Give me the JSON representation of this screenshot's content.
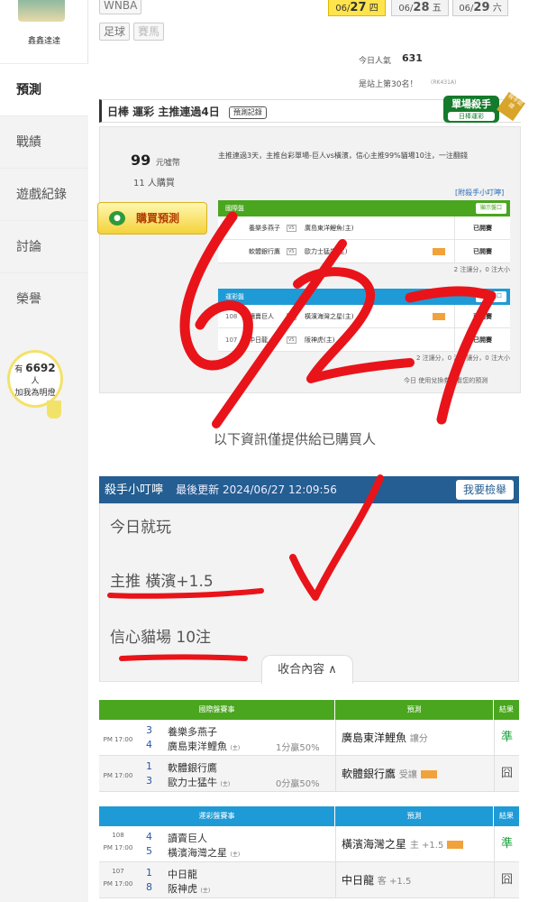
{
  "sidebar": {
    "username": "鑫鑫達達",
    "items": [
      {
        "label": "預測",
        "active": true
      },
      {
        "label": "戰績",
        "active": false
      },
      {
        "label": "遊戲紀錄",
        "active": false
      },
      {
        "label": "討論",
        "active": false
      },
      {
        "label": "榮譽",
        "active": false
      }
    ],
    "fans": {
      "prefix": "有",
      "count": "6692",
      "suffix": "人",
      "cta": "加我為明燈"
    }
  },
  "sport_tags": [
    "WNBA",
    "足球",
    "賽馬"
  ],
  "dates": [
    {
      "month_prefix": "06/",
      "day": "27",
      "weekday": "四",
      "active": true
    },
    {
      "month_prefix": "06/",
      "day": "28",
      "weekday": "五",
      "active": false
    },
    {
      "month_prefix": "06/",
      "day": "29",
      "weekday": "六",
      "active": false
    }
  ],
  "popularity": {
    "label": "今日人氣",
    "value": "631",
    "rank_text": "是站上第30名！",
    "rank_sub": "(RK431A)"
  },
  "prediction": {
    "title": "日棒 運彩 主推連過4日",
    "record_button": "預測記錄",
    "badge_title": "單場殺手",
    "badge_sub": "日棒運彩",
    "badge_corner": "殺手認證",
    "price": "99",
    "price_unit": "元噓幣",
    "buyers": "11 人購買",
    "buy_button": "購買預測",
    "summary": "主推連過3天，主推台彩單場-巨人vs橫濱，信心主推99%貓場10注，一注翻錢",
    "link_note": "[附殺手小叮嚀]",
    "intl_table": {
      "title": "國際盤",
      "show_btn": "顯示盤口",
      "rows": [
        {
          "num": "",
          "home": "養樂多燕子",
          "away": "廣島東洋鯉魚(主)",
          "flag": false,
          "status": "已開賽"
        },
        {
          "num": "",
          "home": "軟體銀行鷹",
          "away": "歐力士猛牛(主)",
          "flag": true,
          "status": "已開賽"
        }
      ],
      "note": "2 注讓分，0 注大小"
    },
    "sport_table": {
      "title": "運彩盤",
      "show_btn": "顯示盤口",
      "rows": [
        {
          "num": "108",
          "home": "讀賣巨人",
          "away": "橫濱海灣之星(主)",
          "flag": true,
          "status": "已開賽"
        },
        {
          "num": "107",
          "home": "中日龍",
          "away": "阪神虎(主)",
          "flag": false,
          "status": "已開賽"
        }
      ],
      "note": "2 注讓分，0 注不讓分，0 注大小"
    },
    "bottom_note": "今日 使用兌換券觀看您的預測"
  },
  "info_line": "以下資訊僅提供給已購買人",
  "notes": {
    "header": "殺手小叮嚀",
    "updated": "最後更新 2024/06/27 12:09:56",
    "report_button": "我要檢舉",
    "line1": "今日就玩",
    "line2": "主推 橫濱+1.5",
    "line3": "信心貓場 10注",
    "collapse_button": "收合內容 ∧"
  },
  "result_tables": [
    {
      "head_event": "國際盤賽事",
      "head_pick": "預測",
      "head_result": "結果",
      "color": "#4aa61f",
      "rows": [
        {
          "time1": "",
          "time2": "PM 17:00",
          "n1": "3",
          "t1": "養樂多燕子",
          "n2": "4",
          "t2": "廣島東洋鯉魚",
          "t2_tag": "(主)",
          "odds": "1分贏50%",
          "pick": "廣島東洋鯉魚",
          "pick_sub": "讓分",
          "flag": false,
          "result": "準",
          "win": true
        },
        {
          "time1": "",
          "time2": "PM 17:00",
          "n1": "1",
          "t1": "軟體銀行鷹",
          "n2": "3",
          "t2": "歐力士猛牛",
          "t2_tag": "(主)",
          "odds": "0分贏50%",
          "pick": "軟體銀行鷹",
          "pick_sub": "受讓",
          "flag": true,
          "result": "囧",
          "win": false
        }
      ]
    },
    {
      "head_event": "運彩盤賽事",
      "head_pick": "預測",
      "head_result": "結果",
      "color": "#1e9bd6",
      "rows": [
        {
          "time1": "108",
          "time2": "PM 17:00",
          "n1": "4",
          "t1": "讀賣巨人",
          "n2": "5",
          "t2": "橫濱海灣之星",
          "t2_tag": "(主)",
          "odds": "",
          "pick": "橫濱海灣之星",
          "pick_sub": "主 +1.5",
          "flag": true,
          "result": "準",
          "win": true
        },
        {
          "time1": "107",
          "time2": "PM 17:00",
          "n1": "1",
          "t1": "中日龍",
          "n2": "8",
          "t2": "阪神虎",
          "t2_tag": "(主)",
          "odds": "",
          "pick": "中日龍",
          "pick_sub": "客 +1.5",
          "flag": false,
          "result": "囧",
          "win": false
        }
      ]
    }
  ],
  "colors": {
    "ink": "#e8141a",
    "header_blue": "#245e92",
    "green": "#4aa61f",
    "blue": "#1e9bd6",
    "yellow": "#ffe44d"
  }
}
